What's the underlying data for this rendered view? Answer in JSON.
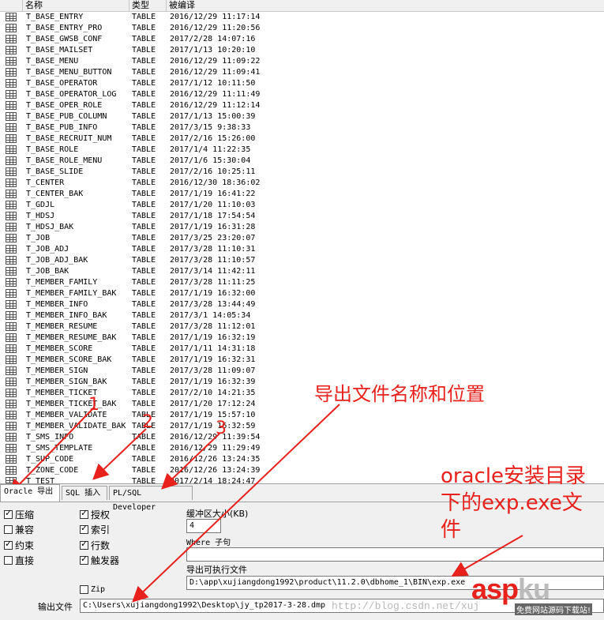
{
  "table": {
    "columns": [
      "名称",
      "类型",
      "被编译"
    ],
    "rows": [
      {
        "name": "T_BASE_ENTRY",
        "type": "TABLE",
        "date": "2016/12/29 11:17:14"
      },
      {
        "name": "T_BASE_ENTRY_PRO",
        "type": "TABLE",
        "date": "2016/12/29 11:20:56"
      },
      {
        "name": "T_BASE_GWSB_CONF",
        "type": "TABLE",
        "date": "2017/2/28 14:07:16"
      },
      {
        "name": "T_BASE_MAILSET",
        "type": "TABLE",
        "date": "2017/1/13 10:20:10"
      },
      {
        "name": "T_BASE_MENU",
        "type": "TABLE",
        "date": "2016/12/29 11:09:22"
      },
      {
        "name": "T_BASE_MENU_BUTTON",
        "type": "TABLE",
        "date": "2016/12/29 11:09:41"
      },
      {
        "name": "T_BASE_OPERATOR",
        "type": "TABLE",
        "date": "2017/1/12 10:11:50"
      },
      {
        "name": "T_BASE_OPERATOR_LOG",
        "type": "TABLE",
        "date": "2016/12/29 11:11:49"
      },
      {
        "name": "T_BASE_OPER_ROLE",
        "type": "TABLE",
        "date": "2016/12/29 11:12:14"
      },
      {
        "name": "T_BASE_PUB_COLUMN",
        "type": "TABLE",
        "date": "2017/1/13 15:00:39"
      },
      {
        "name": "T_BASE_PUB_INFO",
        "type": "TABLE",
        "date": "2017/3/15 9:38:33"
      },
      {
        "name": "T_BASE_RECRUIT_NUM",
        "type": "TABLE",
        "date": "2017/2/16 15:26:00"
      },
      {
        "name": "T_BASE_ROLE",
        "type": "TABLE",
        "date": "2017/1/4 11:22:35"
      },
      {
        "name": "T_BASE_ROLE_MENU",
        "type": "TABLE",
        "date": "2017/1/6 15:30:04"
      },
      {
        "name": "T_BASE_SLIDE",
        "type": "TABLE",
        "date": "2017/2/16 10:25:11"
      },
      {
        "name": "T_CENTER",
        "type": "TABLE",
        "date": "2016/12/30 18:36:02"
      },
      {
        "name": "T_CENTER_BAK",
        "type": "TABLE",
        "date": "2017/1/19 16:41:22"
      },
      {
        "name": "T_GDJL",
        "type": "TABLE",
        "date": "2017/1/20 11:10:03"
      },
      {
        "name": "T_HDSJ",
        "type": "TABLE",
        "date": "2017/1/18 17:54:54"
      },
      {
        "name": "T_HDSJ_BAK",
        "type": "TABLE",
        "date": "2017/1/19 16:31:28"
      },
      {
        "name": "T_JOB",
        "type": "TABLE",
        "date": "2017/3/25 23:20:07"
      },
      {
        "name": "T_JOB_ADJ",
        "type": "TABLE",
        "date": "2017/3/28 11:10:31"
      },
      {
        "name": "T_JOB_ADJ_BAK",
        "type": "TABLE",
        "date": "2017/3/28 11:10:57"
      },
      {
        "name": "T_JOB_BAK",
        "type": "TABLE",
        "date": "2017/3/14 11:42:11"
      },
      {
        "name": "T_MEMBER_FAMILY",
        "type": "TABLE",
        "date": "2017/3/28 11:11:25"
      },
      {
        "name": "T_MEMBER_FAMILY_BAK",
        "type": "TABLE",
        "date": "2017/1/19 16:32:00"
      },
      {
        "name": "T_MEMBER_INFO",
        "type": "TABLE",
        "date": "2017/3/28 13:44:49"
      },
      {
        "name": "T_MEMBER_INFO_BAK",
        "type": "TABLE",
        "date": "2017/3/1 14:05:34"
      },
      {
        "name": "T_MEMBER_RESUME",
        "type": "TABLE",
        "date": "2017/3/28 11:12:01"
      },
      {
        "name": "T_MEMBER_RESUME_BAK",
        "type": "TABLE",
        "date": "2017/1/19 16:32:19"
      },
      {
        "name": "T_MEMBER_SCORE",
        "type": "TABLE",
        "date": "2017/1/11 14:31:18"
      },
      {
        "name": "T_MEMBER_SCORE_BAK",
        "type": "TABLE",
        "date": "2017/1/19 16:32:31"
      },
      {
        "name": "T_MEMBER_SIGN",
        "type": "TABLE",
        "date": "2017/3/28 11:09:07"
      },
      {
        "name": "T_MEMBER_SIGN_BAK",
        "type": "TABLE",
        "date": "2017/1/19 16:32:39"
      },
      {
        "name": "T_MEMBER_TICKET",
        "type": "TABLE",
        "date": "2017/2/10 14:21:35"
      },
      {
        "name": "T_MEMBER_TICKET_BAK",
        "type": "TABLE",
        "date": "2017/1/20 17:12:24"
      },
      {
        "name": "T_MEMBER_VALIDATE",
        "type": "TABLE",
        "date": "2017/1/19 15:57:10"
      },
      {
        "name": "T_MEMBER_VALIDATE_BAK",
        "type": "TABLE",
        "date": "2017/1/19 16:32:59"
      },
      {
        "name": "T_SMS_INFO",
        "type": "TABLE",
        "date": "2016/12/29 11:39:54"
      },
      {
        "name": "T_SMS_TEMPLATE",
        "type": "TABLE",
        "date": "2016/12/29 11:29:49"
      },
      {
        "name": "T_SUP_CODE",
        "type": "TABLE",
        "date": "2016/12/26 13:24:35"
      },
      {
        "name": "T_ZONE_CODE",
        "type": "TABLE",
        "date": "2016/12/26 13:24:39"
      },
      {
        "name": "T_TEST",
        "type": "TABLE",
        "date": "2017/2/14 18:24:47"
      }
    ]
  },
  "tabs": [
    "Oracle 导出",
    "SQL 插入",
    "PL/SQL Developer"
  ],
  "options": {
    "col1": [
      {
        "label": "压缩",
        "checked": true
      },
      {
        "label": "兼容",
        "checked": false
      },
      {
        "label": "约束",
        "checked": true
      },
      {
        "label": "直接",
        "checked": false
      }
    ],
    "col2": [
      {
        "label": "授权",
        "checked": true
      },
      {
        "label": "索引",
        "checked": true
      },
      {
        "label": "行数",
        "checked": true
      },
      {
        "label": "触发器",
        "checked": true
      }
    ],
    "zip": {
      "label": "Zip",
      "checked": false
    }
  },
  "buffer": {
    "label": "缓冲区大小(KB)",
    "value": "4"
  },
  "where": {
    "label": "Where 子句",
    "value": ""
  },
  "exe": {
    "label": "导出可执行文件",
    "value": "D:\\app\\xujiangdong1992\\product\\11.2.0\\dbhome_1\\BIN\\exp.exe"
  },
  "output": {
    "label": "输出文件",
    "value": "C:\\Users\\xujiangdong1992\\Desktop\\jy_tp2017-3-28.dmp"
  },
  "annotations": {
    "n1": "1",
    "n2": "2",
    "n3": "3",
    "export_note": "导出文件名称和位置",
    "exe_note": "oracle安装目录下的exp.exe文件"
  },
  "watermark": "http://blog.csdn.net/xuj",
  "logo": {
    "asp": "asp",
    "ku": "ku",
    "sub": "免费网站源码下载站!"
  },
  "colors": {
    "annotation": "#e8211c",
    "watermark": "#b8b8b8"
  }
}
